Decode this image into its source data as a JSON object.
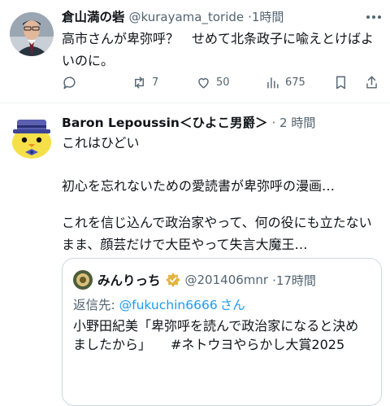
{
  "post1": {
    "display_name": "倉山満の砦",
    "handle": "@kurayama_toride",
    "time": "·1時間",
    "text": "高市さんが卑弥呼？　せめて北条政子に喩えとけばよいのに。",
    "actions": {
      "replies": "",
      "reposts": "7",
      "likes": "50",
      "views": "675"
    }
  },
  "post2": {
    "display_name": "Baron Lepoussin＜ひよこ男爵＞",
    "time": "· 2 時間",
    "paragraphs": [
      "これはひどい",
      "初心を忘れないための愛読書が卑弥呼の漫画…",
      "これを信じ込んで政治家やって、何の役にも立たないまま、顔芸だけで大臣やって失言大魔王…"
    ]
  },
  "quote": {
    "display_name": "みんりっち",
    "handle": "@201406mnr",
    "time": "·17時間",
    "reply_prefix": "返信先: ",
    "reply_to": "@fukuchin6666",
    "reply_suffix": "さん",
    "text": "小野田紀美「卑弥呼を読んで政治家になると決めましたから」　　#ネトウヨやらかし大賞2025"
  },
  "colors": {
    "link": "#1d9bf0",
    "meta": "#536471",
    "text": "#0f1419"
  }
}
